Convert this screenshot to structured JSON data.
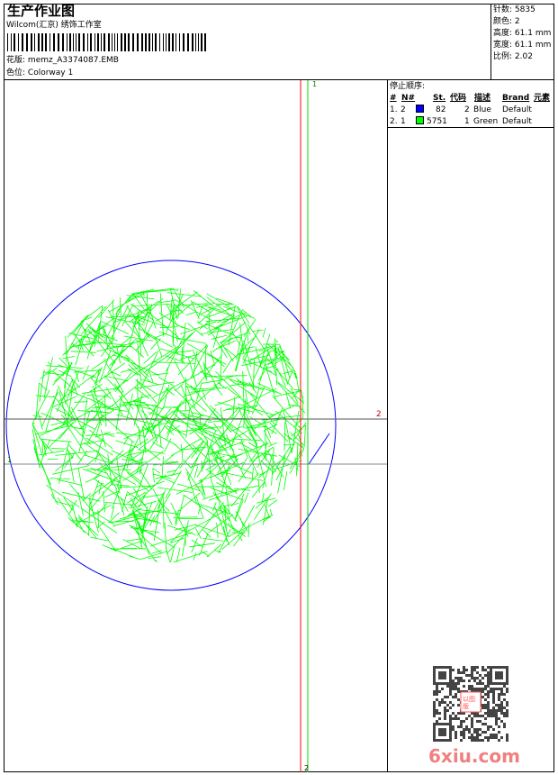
{
  "header": {
    "title": "生产作业图",
    "company": "Wilcom(汇京) 绣饰工作室",
    "design_label": "花版:",
    "design": "memz_A3374087.EMB",
    "colorway_label": "色位:",
    "colorway": "Colorway 1"
  },
  "stats": [
    {
      "label": "针数:",
      "value": "5835"
    },
    {
      "label": "颜色:",
      "value": "2"
    },
    {
      "label": "高度:",
      "value": "61.1 mm"
    },
    {
      "label": "宽度:",
      "value": "61.1 mm"
    },
    {
      "label": "比例:",
      "value": "2.02"
    }
  ],
  "stop_sequence": {
    "title": "停止顺序:",
    "columns": [
      "#",
      "N#",
      "St.",
      "代码",
      "描述",
      "Brand",
      "元素"
    ],
    "rows": [
      {
        "index": "1.",
        "needle": "2",
        "color": "#0000ff",
        "stitches": "82",
        "code": "2",
        "desc": "Blue",
        "brand": "Default"
      },
      {
        "index": "2.",
        "needle": "1",
        "color": "#00ff00",
        "stitches": "5751",
        "code": "1",
        "desc": "Green",
        "brand": "Default"
      }
    ]
  },
  "guides": {
    "v_green_label": "1",
    "v_red_label": "2",
    "h_red_label": "2",
    "h_green_label": "1"
  },
  "colors": {
    "outline": "#0000ff",
    "fill": "#00ff00",
    "guide_red": "#ff0000",
    "guide_green": "#00ff00"
  },
  "watermark": "6xiu.com",
  "stamp": "以图版"
}
